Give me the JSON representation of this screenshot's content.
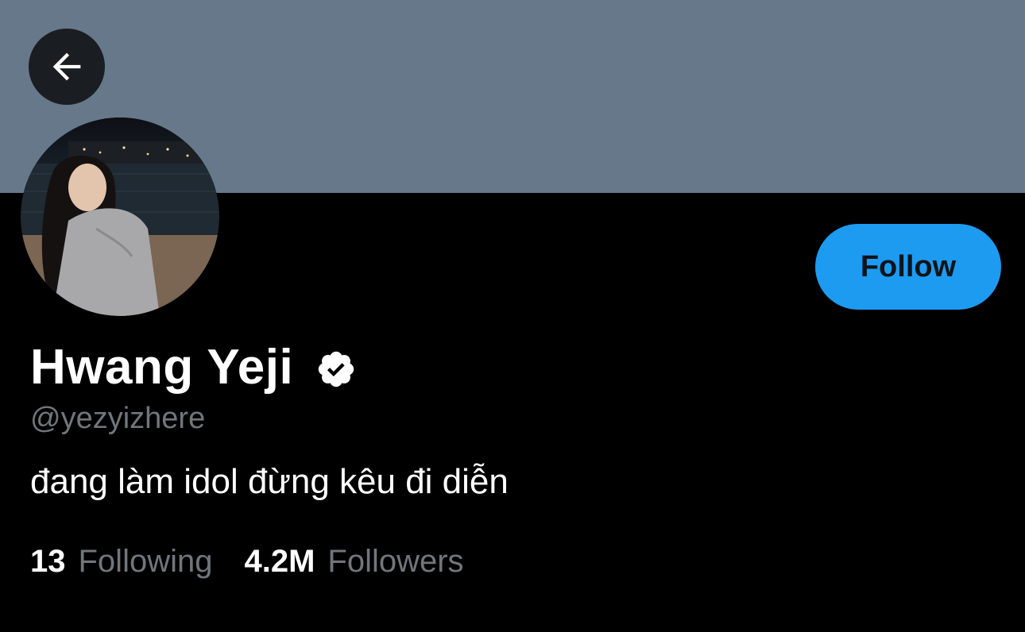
{
  "profile": {
    "display_name": "Hwang Yeji",
    "handle": "@yezyizhere",
    "bio": "đang làm idol đừng kêu đi diễn",
    "verified": true
  },
  "actions": {
    "follow_label": "Follow"
  },
  "stats": {
    "following_count": "13",
    "following_label": "Following",
    "followers_count": "4.2M",
    "followers_label": "Followers"
  },
  "icons": {
    "back": "arrow-left-icon",
    "verified": "verified-badge-icon"
  },
  "colors": {
    "banner": "#66788a",
    "background": "#000000",
    "accent": "#1d9bf0",
    "secondary_text": "#71767b",
    "primary_text": "#ffffff"
  }
}
